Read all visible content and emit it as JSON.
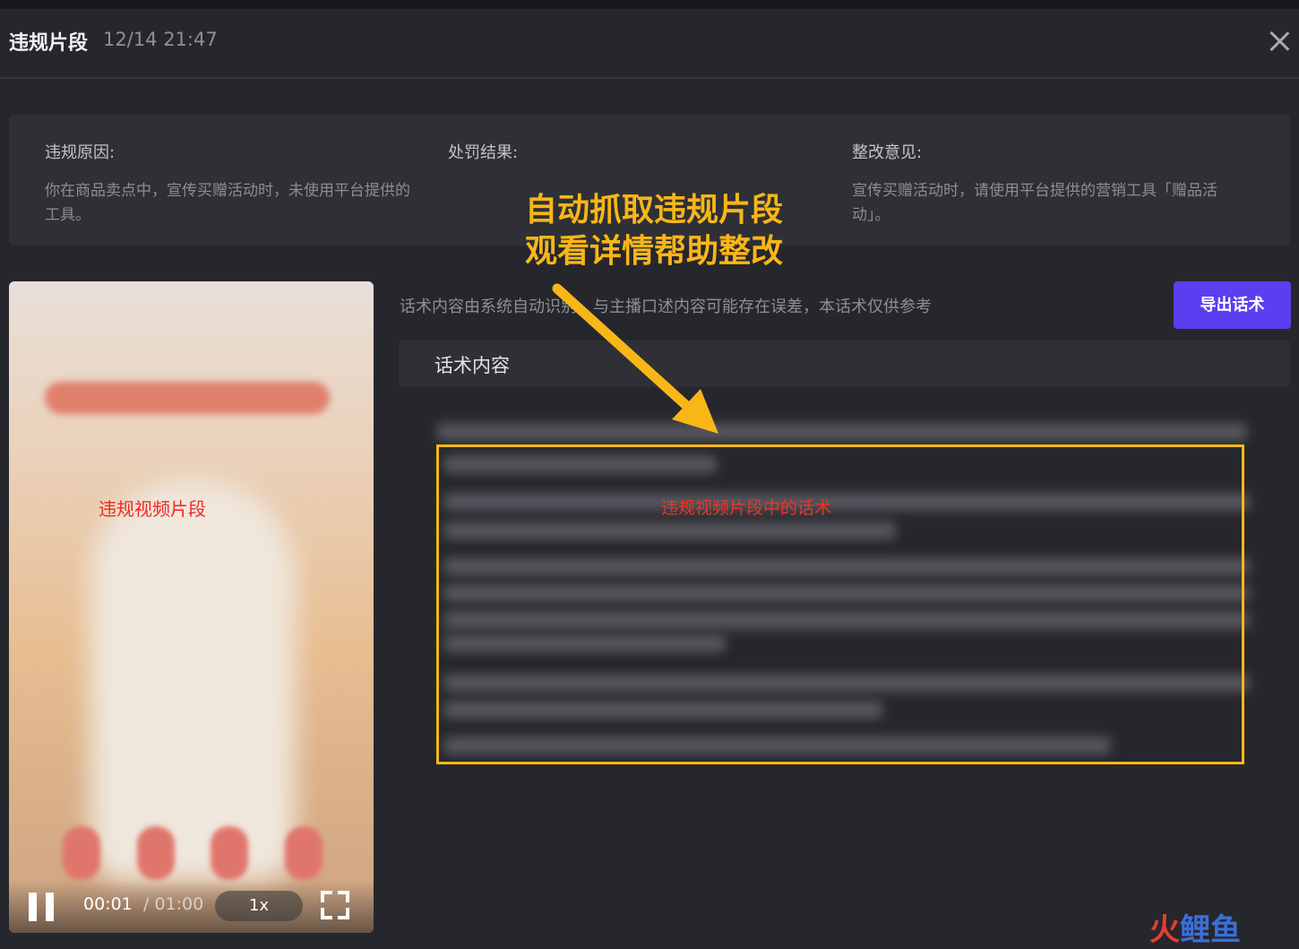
{
  "header": {
    "title": "违规片段",
    "time": "12/14 21:47"
  },
  "info": {
    "reason_label": "违规原因:",
    "reason_text": "你在商品卖点中，宣传买赠活动时，未使用平台提供的工具。",
    "penalty_label": "处罚结果:",
    "advice_label": "整改意见:",
    "advice_text": "宣传买赠活动时，请使用平台提供的营销工具「赠品活动」。"
  },
  "annotation": {
    "line1": "自动抓取违规片段",
    "line2": "观看详情帮助整改"
  },
  "video": {
    "label": "违规视频片段",
    "current_time": "00:01",
    "duration": "/ 01:00",
    "rate": "1x"
  },
  "script": {
    "notice": "话术内容由系统自动识别，与主播口述内容可能存在误差，本话术仅供参考",
    "export_label": "导出话术",
    "header": "话术内容",
    "highlight_label": "违规视频片段中的话术"
  },
  "watermark": {
    "red": "火",
    "blue": "鲤鱼"
  },
  "colors": {
    "accent": "#5a3ff0",
    "annotation": "#f8b617",
    "highlight": "#f6b81a",
    "violation_text": "#ec3525"
  }
}
